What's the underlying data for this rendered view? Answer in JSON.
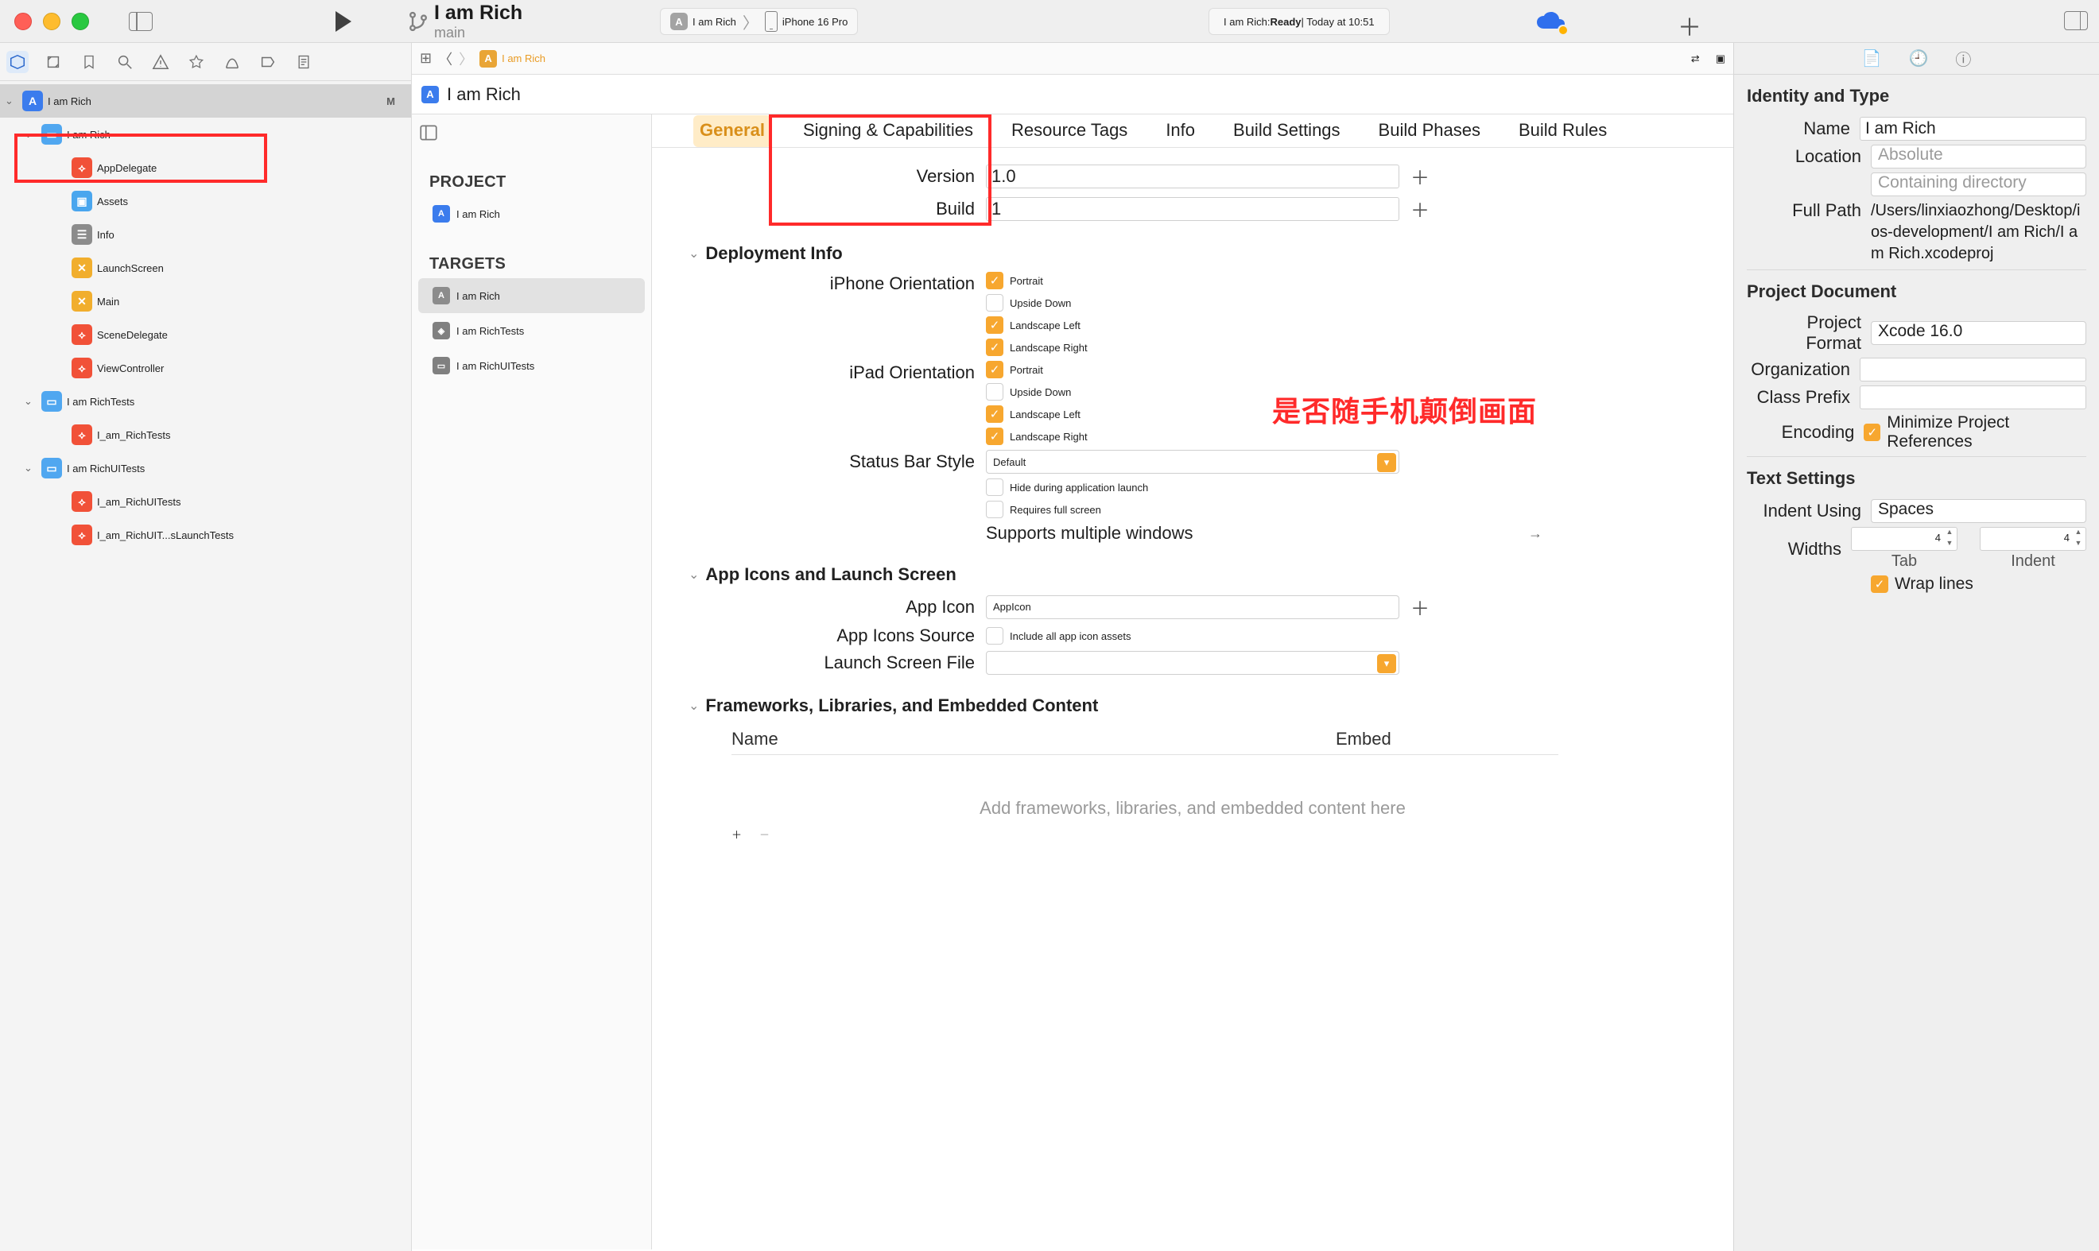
{
  "toolbar": {
    "branch_project": "I am Rich",
    "branch_name": "main",
    "scheme_app": "I am Rich",
    "scheme_device": "iPhone 16 Pro",
    "status_prefix": "I am Rich: ",
    "status_state": "Ready",
    "status_suffix": " | Today at 10:51"
  },
  "navigator": {
    "root": "I am Rich",
    "root_badge": "M",
    "group_app": "I am Rich",
    "files_app": [
      "AppDelegate",
      "Assets",
      "Info",
      "LaunchScreen",
      "Main",
      "SceneDelegate",
      "ViewController"
    ],
    "group_tests": "I am RichTests",
    "files_tests": [
      "I_am_RichTests"
    ],
    "group_uitests": "I am RichUITests",
    "files_uitests": [
      "I_am_RichUITests",
      "I_am_RichUIT...sLaunchTests"
    ]
  },
  "jumpbar": {
    "crumb": "I am Rich",
    "sub": "I am Rich"
  },
  "proj_col": {
    "project_hdr": "PROJECT",
    "project_item": "I am Rich",
    "targets_hdr": "TARGETS",
    "targets": [
      "I am Rich",
      "I am RichTests",
      "I am RichUITests"
    ]
  },
  "tabs": [
    "General",
    "Signing & Capabilities",
    "Resource Tags",
    "Info",
    "Build Settings",
    "Build Phases",
    "Build Rules"
  ],
  "form": {
    "version_label": "Version",
    "version_value": "1.0",
    "build_label": "Build",
    "build_value": "1",
    "deploy_hdr": "Deployment Info",
    "iphone_orient_label": "iPhone Orientation",
    "ipad_orient_label": "iPad Orientation",
    "orient_opts": [
      "Portrait",
      "Upside Down",
      "Landscape Left",
      "Landscape Right"
    ],
    "iphone_orient_state": [
      true,
      false,
      true,
      true
    ],
    "ipad_orient_state": [
      true,
      false,
      true,
      true
    ],
    "status_bar_label": "Status Bar Style",
    "status_bar_value": "Default",
    "hide_launch": "Hide during application launch",
    "fullscreen": "Requires full screen",
    "multi_win": "Supports multiple windows",
    "appicons_hdr": "App Icons and Launch Screen",
    "appicon_label": "App Icon",
    "appicon_value": "AppIcon",
    "appicon_src_label": "App Icons Source",
    "appicon_src_cb": "Include all app icon assets",
    "launch_file_label": "Launch Screen File",
    "frameworks_hdr": "Frameworks, Libraries, and Embedded Content",
    "col_name": "Name",
    "col_embed": "Embed",
    "empty_hint": "Add frameworks, libraries, and embedded content here"
  },
  "annotation": "是否随手机颠倒画面",
  "inspector": {
    "identity_hdr": "Identity and Type",
    "name_label": "Name",
    "name_value": "I am Rich",
    "location_label": "Location",
    "location_placeholder": "Absolute",
    "containing_placeholder": "Containing directory",
    "fullpath_label": "Full Path",
    "fullpath_value": "/Users/linxiaozhong/Desktop/ios-development/I am Rich/I am Rich.xcodeproj",
    "projdoc_hdr": "Project Document",
    "projformat_label": "Project Format",
    "projformat_value": "Xcode 16.0",
    "org_label": "Organization",
    "prefix_label": "Class Prefix",
    "encoding_label": "Encoding",
    "encoding_cb": "Minimize Project References",
    "text_hdr": "Text Settings",
    "indent_using_label": "Indent Using",
    "indent_using_value": "Spaces",
    "widths_label": "Widths",
    "tab_value": "4",
    "indent_value": "4",
    "tab_sub": "Tab",
    "indent_sub": "Indent",
    "wrap_label": "Wrap lines"
  }
}
